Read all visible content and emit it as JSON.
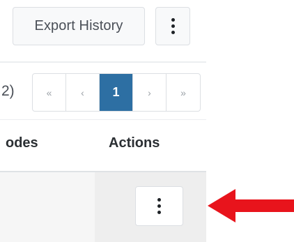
{
  "toolbar": {
    "export_label": "Export History",
    "more_icon": "kebab-vertical-icon"
  },
  "pagination": {
    "count_fragment": "2)",
    "first_label": "«",
    "prev_label": "‹",
    "current_page": "1",
    "next_label": "›",
    "last_label": "»"
  },
  "table": {
    "columns": [
      "odes",
      "Actions"
    ],
    "rows": [
      {
        "actions_icon": "kebab-vertical-icon"
      }
    ]
  },
  "annotation": {
    "arrow_color": "#e8141c",
    "arrow_direction": "left"
  },
  "colors": {
    "accent": "#2d6fa3",
    "border": "#dcdfe3",
    "text": "#2b2f33"
  }
}
